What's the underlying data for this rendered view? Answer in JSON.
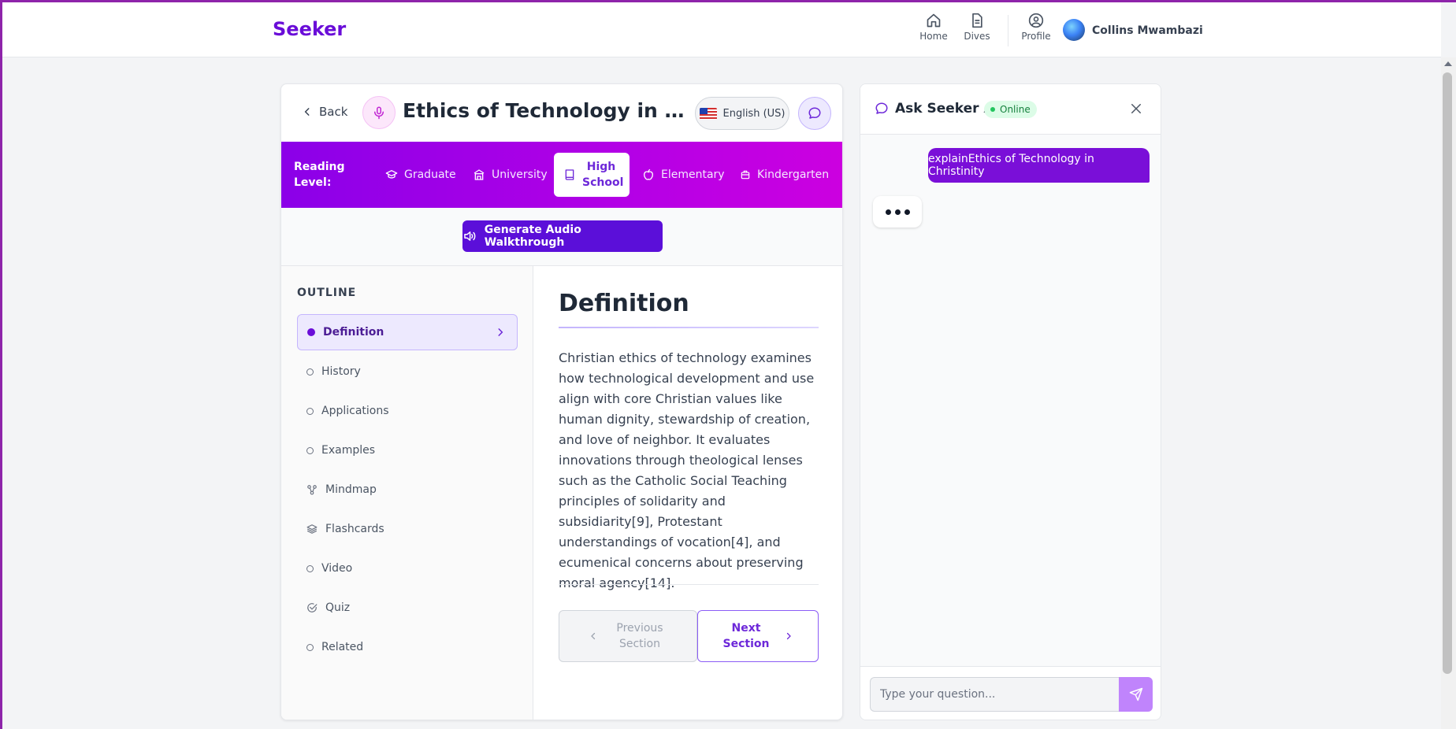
{
  "app": {
    "brand": "Seeker"
  },
  "nav": {
    "home": "Home",
    "dives": "Dives",
    "profile": "Profile",
    "user_name": "Collins Mwambazi"
  },
  "header": {
    "back": "Back",
    "title": "Ethics of Technology in Christinity",
    "language": "English (US)"
  },
  "reading_level": {
    "label": "Reading Level:",
    "levels": [
      {
        "label": "Graduate",
        "icon": "graduation-cap-icon",
        "active": false
      },
      {
        "label": "University",
        "icon": "university-building-icon",
        "active": false
      },
      {
        "label": "High School",
        "icon": "book-icon",
        "active": true
      },
      {
        "label": "Elementary",
        "icon": "apple-icon",
        "active": false
      },
      {
        "label": "Kindergarten",
        "icon": "backpack-icon",
        "active": false
      }
    ]
  },
  "audio": {
    "button": "Generate Audio Walkthrough"
  },
  "outline": {
    "title": "OUTLINE",
    "items": [
      {
        "label": "Definition",
        "icon": "filled-dot",
        "active": true
      },
      {
        "label": "History",
        "icon": "circle-dot"
      },
      {
        "label": "Applications",
        "icon": "circle-dot"
      },
      {
        "label": "Examples",
        "icon": "circle-dot"
      },
      {
        "label": "Mindmap",
        "icon": "mindmap-icon"
      },
      {
        "label": "Flashcards",
        "icon": "layers-icon"
      },
      {
        "label": "Video",
        "icon": "circle-dot"
      },
      {
        "label": "Quiz",
        "icon": "check-circle-icon"
      },
      {
        "label": "Related",
        "icon": "circle-dot"
      }
    ]
  },
  "section": {
    "heading": "Definition",
    "body": "Christian ethics of technology examines how technological development and use align with core Christian values like human dignity, stewardship of creation, and love of neighbor. It evaluates innovations through theological lenses such as the Catholic Social Teaching principles of solidarity and subsidiarity[9], Protestant understandings of vocation[4], and ecumenical concerns about preserving moral agency[14].",
    "prev": "Previous Section",
    "next": "Next Section"
  },
  "chat": {
    "title": "Ask Seeker AI",
    "status": "Online",
    "user_message": "explainEthics of Technology in Christinity",
    "input_placeholder": "Type your question..."
  },
  "colors": {
    "brand": "#6a0dd8",
    "reading_bar_start": "#8b00e8",
    "reading_bar_end": "#cc00e0",
    "audio_button": "#5b0fd9",
    "user_bubble": "#7a0fd8",
    "online_badge": "#dcfce7"
  }
}
